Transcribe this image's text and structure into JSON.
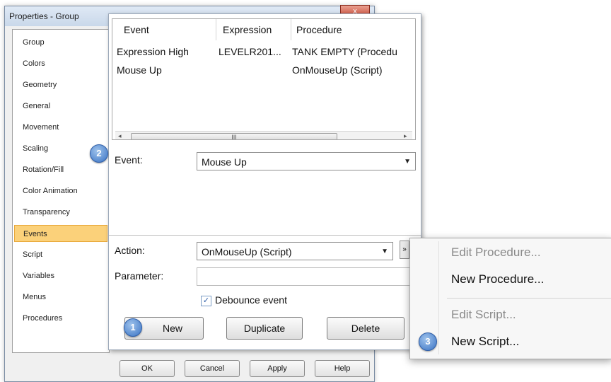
{
  "window": {
    "title": "Properties - Group",
    "close_glyph": "x"
  },
  "sidebar": {
    "items": [
      {
        "label": "Group"
      },
      {
        "label": "Colors"
      },
      {
        "label": "Geometry"
      },
      {
        "label": "General"
      },
      {
        "label": "Movement"
      },
      {
        "label": "Scaling"
      },
      {
        "label": "Rotation/Fill"
      },
      {
        "label": "Color Animation"
      },
      {
        "label": "Transparency"
      },
      {
        "label": "Events",
        "selected": true
      },
      {
        "label": "Script"
      },
      {
        "label": "Variables"
      },
      {
        "label": "Menus"
      },
      {
        "label": "Procedures"
      }
    ]
  },
  "footer": {
    "ok": "OK",
    "cancel": "Cancel",
    "apply": "Apply",
    "help": "Help"
  },
  "events_table": {
    "headers": [
      "Event",
      "Expression",
      "Procedure"
    ],
    "rows": [
      [
        "Expression High",
        "LEVELR201...",
        "TANK EMPTY (Procedu"
      ],
      [
        "Mouse Up",
        "",
        "OnMouseUp (Script)"
      ]
    ],
    "scroll_thumb_glyph": "III",
    "scroll_left_glyph": "◂",
    "scroll_right_glyph": "▸"
  },
  "event_field": {
    "label": "Event:",
    "value": "Mouse Up"
  },
  "action_field": {
    "label": "Action:",
    "value": "OnMouseUp (Script)"
  },
  "parameter_field": {
    "label": "Parameter:",
    "value": ""
  },
  "debounce": {
    "label": "Debounce event",
    "checked": true,
    "check_glyph": "✓"
  },
  "buttons": {
    "new": "New",
    "duplicate": "Duplicate",
    "delete": "Delete"
  },
  "dropdown_glyph": "▼",
  "more_glyph": "»",
  "badges": {
    "one": "1",
    "two": "2",
    "three": "3"
  },
  "context_menu": {
    "items": [
      {
        "label": "Edit Procedure...",
        "enabled": false
      },
      {
        "label": "New Procedure...",
        "enabled": true
      },
      {
        "label": "Edit Script...",
        "enabled": false
      },
      {
        "label": "New Script...",
        "enabled": true
      }
    ]
  },
  "colors": {
    "selected_item": "#fbd17a",
    "badge": "#3a73c4",
    "close": "#c8402a"
  }
}
